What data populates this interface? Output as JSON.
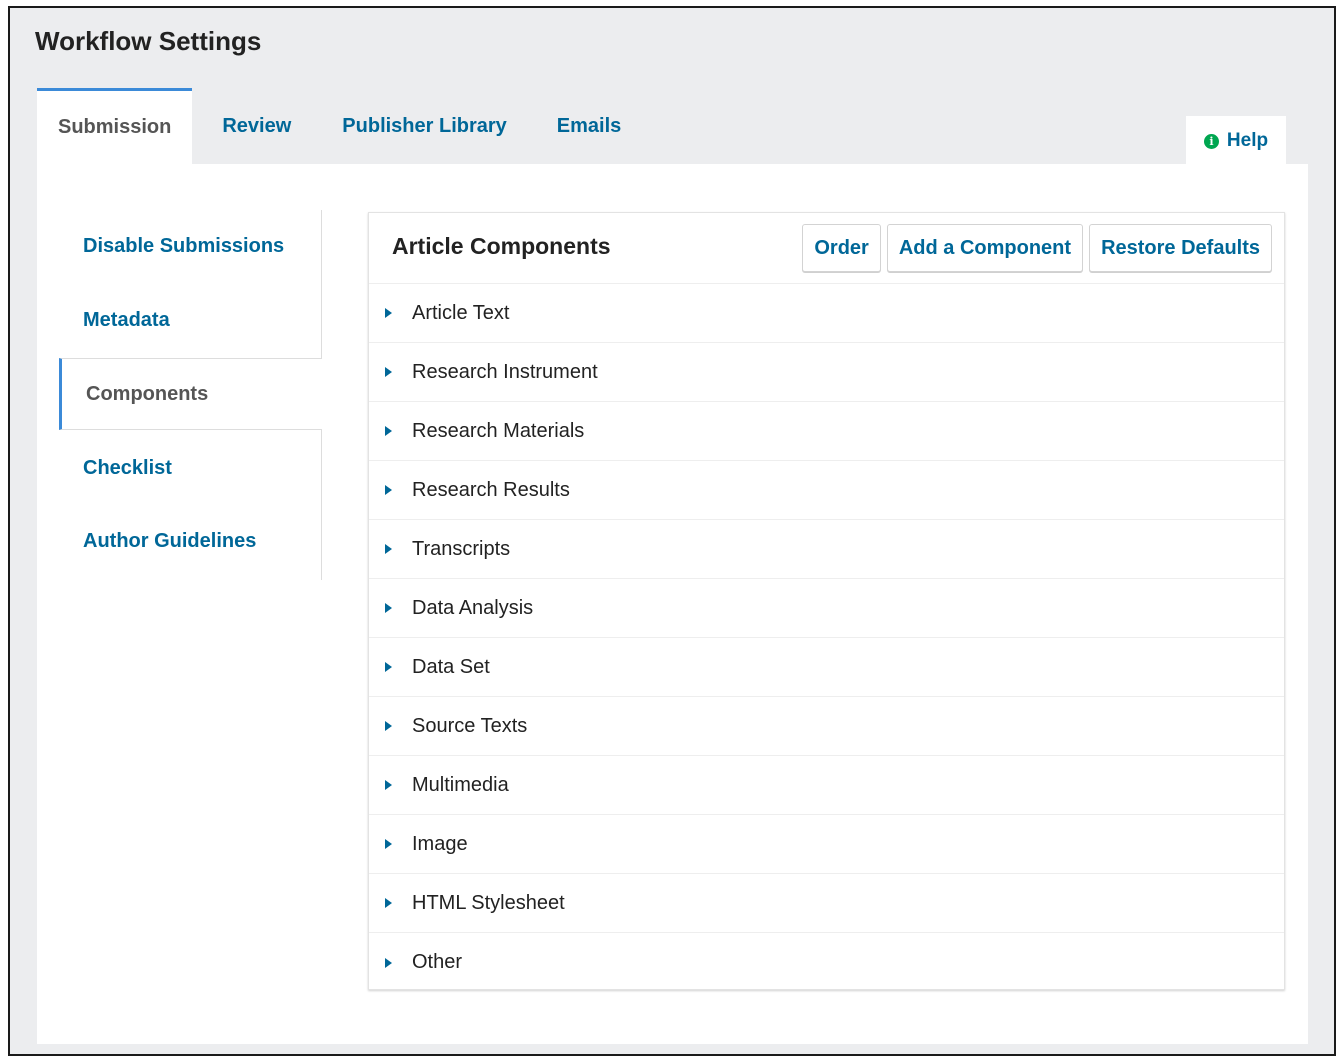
{
  "page": {
    "title": "Workflow Settings"
  },
  "tabs": [
    {
      "label": "Submission",
      "active": true
    },
    {
      "label": "Review",
      "active": false
    },
    {
      "label": "Publisher Library",
      "active": false
    },
    {
      "label": "Emails",
      "active": false
    }
  ],
  "help": {
    "label": "Help",
    "icon": "info-circle-icon",
    "icon_color": "#00a650"
  },
  "side_nav": [
    {
      "label": "Disable Submissions",
      "active": false
    },
    {
      "label": "Metadata",
      "active": false
    },
    {
      "label": "Components",
      "active": true
    },
    {
      "label": "Checklist",
      "active": false
    },
    {
      "label": "Author Guidelines",
      "active": false
    }
  ],
  "panel": {
    "title": "Article Components",
    "actions": {
      "order": "Order",
      "add": "Add a Component",
      "restore": "Restore Defaults"
    },
    "items": [
      "Article Text",
      "Research Instrument",
      "Research Materials",
      "Research Results",
      "Transcripts",
      "Data Analysis",
      "Data Set",
      "Source Texts",
      "Multimedia",
      "Image",
      "HTML Stylesheet",
      "Other"
    ]
  },
  "colors": {
    "link": "#006798",
    "accent": "#3b8ad8",
    "background": "#ecedef"
  }
}
